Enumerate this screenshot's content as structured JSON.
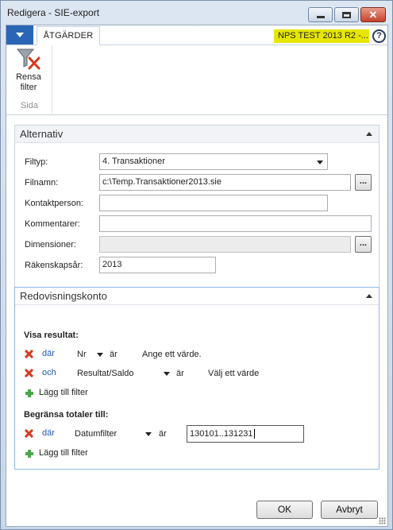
{
  "window": {
    "title": "Redigera - SIE-export"
  },
  "ribbon": {
    "tab_label": "ÅTGÄRDER",
    "company": "NPS TEST 2013 R2 -...",
    "help": "?",
    "clear_filter_label_1": "Rensa",
    "clear_filter_label_2": "filter",
    "group_label": "Sida"
  },
  "alternativ": {
    "title": "Alternativ",
    "fields": {
      "filtyp_label": "Filtyp:",
      "filtyp_value": "4. Transaktioner",
      "filnamn_label": "Filnamn:",
      "filnamn_value": "c:\\Temp.Transaktioner2013.sie",
      "kontakt_label": "Kontaktperson:",
      "kontakt_value": "",
      "kommentarer_label": "Kommentarer:",
      "kommentarer_value": "",
      "dimensioner_label": "Dimensioner:",
      "dimensioner_value": "",
      "rakenskapsar_label": "Räkenskapsår:",
      "rakenskapsar_value": "2013"
    },
    "ellipsis": "..."
  },
  "redovisningskonto": {
    "title": "Redovisningskonto",
    "visa_title": "Visa resultat:",
    "row1": {
      "conj": "där",
      "field": "Nr",
      "op": "är",
      "value": "Ange ett värde."
    },
    "row2": {
      "conj": "och",
      "field": "Resultat/Saldo",
      "op": "är",
      "value": "Välj ett värde"
    },
    "add_filter": "Lägg till filter",
    "begransa_title": "Begränsa totaler till:",
    "row3": {
      "conj": "där",
      "field": "Datumfilter",
      "op": "är",
      "value": "130101..131231"
    },
    "add_filter_2": "Lägg till filter"
  },
  "buttons": {
    "ok": "OK",
    "cancel": "Avbryt"
  },
  "colors": {
    "accent": "#2b65b6",
    "company_badge": "#e6e600",
    "remove": "#d9391c",
    "add": "#49a84a",
    "link": "#1f5bb5"
  }
}
